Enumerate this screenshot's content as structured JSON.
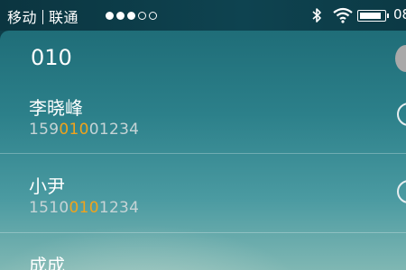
{
  "status_bar": {
    "carrier_1": "移动",
    "carrier_2": "联通",
    "time": "08",
    "signal_icon": "signal-dots-icon",
    "bluetooth_icon": "bluetooth-icon",
    "wifi_icon": "wifi-icon",
    "battery_icon": "battery-icon"
  },
  "search": {
    "query": "010"
  },
  "contacts": [
    {
      "name": "李晓峰",
      "number_pre": "159",
      "number_match": "010",
      "number_post": "01234"
    },
    {
      "name": "小尹",
      "number_pre": "1510",
      "number_match": "010",
      "number_post": "1234"
    },
    {
      "name": "成成"
    }
  ],
  "colors": {
    "highlight": "#f2a31b",
    "accent_bg": "#2c808a"
  }
}
